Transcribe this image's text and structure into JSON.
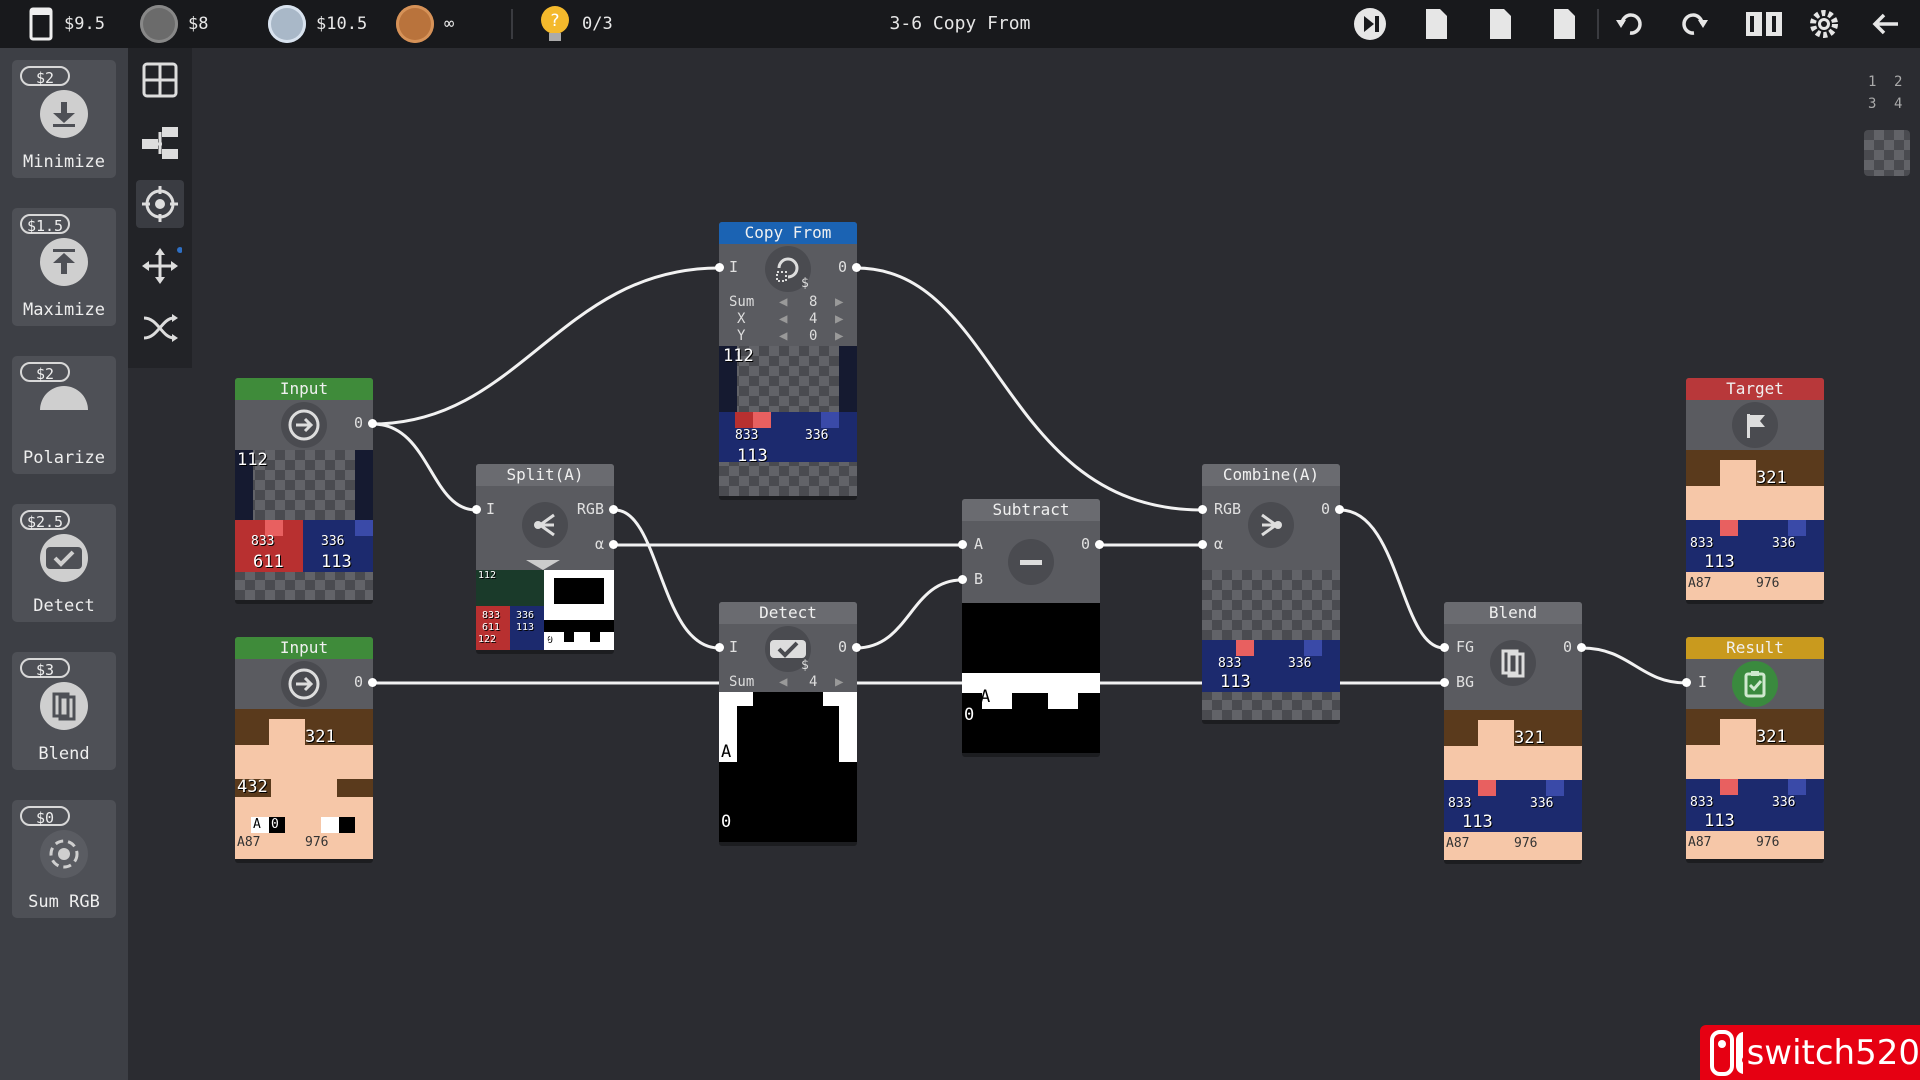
{
  "topbar": {
    "balance": "$9.5",
    "medal_gold": "$8",
    "medal_silver": "$10.5",
    "medal_bronze": "∞",
    "hints": "0/3",
    "level_title": "3-6 Copy From"
  },
  "sidebar": {
    "items": [
      {
        "price": "$2",
        "label": "Minimize",
        "icon": "minimize-icon"
      },
      {
        "price": "$1.5",
        "label": "Maximize",
        "icon": "maximize-icon"
      },
      {
        "price": "$2",
        "label": "Polarize",
        "icon": "polarize-icon"
      },
      {
        "price": "$2.5",
        "label": "Detect",
        "icon": "detect-icon"
      },
      {
        "price": "$3",
        "label": "Blend",
        "icon": "blend-icon"
      },
      {
        "price": "$0",
        "label": "Sum RGB",
        "icon": "sum-rgb-icon"
      }
    ]
  },
  "layers": [
    "1",
    "2",
    "3",
    "4"
  ],
  "nodes": {
    "copy_from": {
      "title": "Copy From",
      "in": "I",
      "out": "0",
      "param_sum": "Sum",
      "param_sum_val": "8",
      "param_x": "X",
      "param_x_val": "4",
      "param_y": "Y",
      "param_y_val": "0",
      "n1": "112",
      "n2": "833",
      "n3": "336",
      "n4": "113",
      "cost": "$"
    },
    "input1": {
      "title": "Input",
      "out": "0",
      "n1": "112",
      "n2": "833",
      "n3": "336",
      "n4": "611",
      "n5": "113"
    },
    "input2": {
      "title": "Input",
      "out": "0",
      "n1": "321",
      "n2": "432",
      "n3": "A",
      "n4": "0",
      "n5": "A87",
      "n6": "976"
    },
    "split": {
      "title": "Split(A)",
      "in": "I",
      "out_rgb": "RGB",
      "out_a": "α",
      "n1": "112",
      "n2": "833",
      "n3": "611",
      "n4": "336",
      "n5": "113",
      "n6": "122",
      "n7": "0"
    },
    "detect": {
      "title": "Detect",
      "in": "I",
      "out": "0",
      "param_sum": "Sum",
      "param_sum_val": "4",
      "n1": "A",
      "n2": "0",
      "cost": "$"
    },
    "subtract": {
      "title": "Subtract",
      "in_a": "A",
      "in_b": "B",
      "out": "0",
      "n1": "A",
      "n2": "0"
    },
    "combine": {
      "title": "Combine(A)",
      "in_rgb": "RGB",
      "in_a": "α",
      "out": "0",
      "n1": "833",
      "n2": "336",
      "n3": "113"
    },
    "blend": {
      "title": "Blend",
      "in_fg": "FG",
      "in_bg": "BG",
      "out": "0",
      "n1": "321",
      "n2": "833",
      "n3": "336",
      "n4": "113",
      "n5": "A87",
      "n6": "976"
    },
    "target": {
      "title": "Target",
      "n1": "321",
      "n2": "833",
      "n3": "336",
      "n4": "113",
      "n5": "A87",
      "n6": "976"
    },
    "result": {
      "title": "Result",
      "in": "I",
      "n1": "321",
      "n2": "833",
      "n3": "336",
      "n4": "113",
      "n5": "A87",
      "n6": "976"
    }
  },
  "watermark": "switch520",
  "colors": {
    "input_header": "#3f8b3a",
    "copy_header": "#1b63b3",
    "target_header": "#b8383a",
    "result_header": "#c99a1e",
    "node_header": "#6a6b70",
    "skin": "#f6c7a8",
    "hair": "#5a3a1c",
    "navy": "#1c2a6e",
    "red": "#b83030"
  }
}
